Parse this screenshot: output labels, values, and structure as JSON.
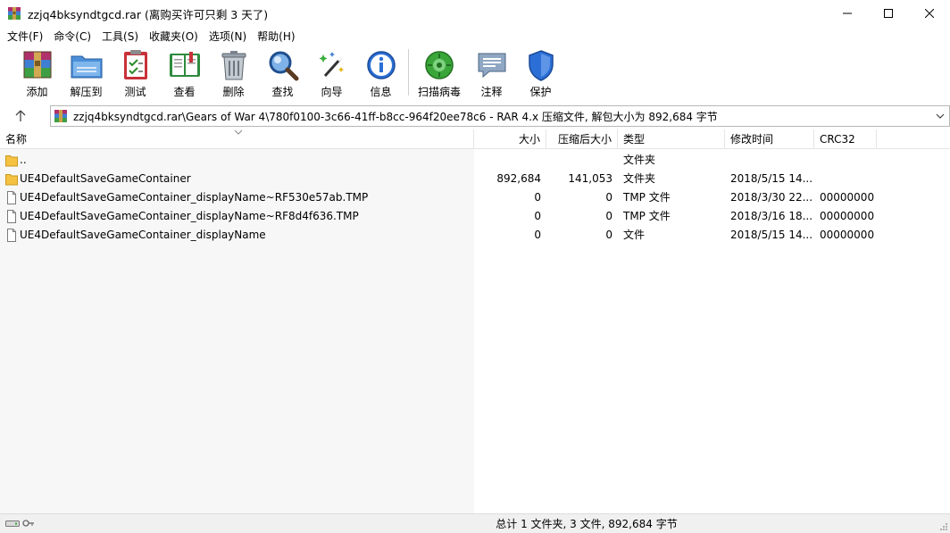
{
  "window": {
    "title": "zzjq4bksyndtgcd.rar (离购买许可只剩 3 天了)",
    "minimize_icon": "minimize-icon",
    "maximize_icon": "maximize-icon",
    "close_icon": "close-icon"
  },
  "menu": [
    {
      "label": "文件(F)"
    },
    {
      "label": "命令(C)"
    },
    {
      "label": "工具(S)"
    },
    {
      "label": "收藏夹(O)"
    },
    {
      "label": "选项(N)"
    },
    {
      "label": "帮助(H)"
    }
  ],
  "toolbar": [
    {
      "label": "添加",
      "icon": "add-archive-icon"
    },
    {
      "label": "解压到",
      "icon": "extract-folder-icon"
    },
    {
      "label": "测试",
      "icon": "test-clipboard-icon"
    },
    {
      "label": "查看",
      "icon": "view-book-icon"
    },
    {
      "label": "删除",
      "icon": "trash-icon"
    },
    {
      "label": "查找",
      "icon": "magnifier-icon"
    },
    {
      "label": "向导",
      "icon": "wizard-wand-icon"
    },
    {
      "label": "信息",
      "icon": "info-icon"
    },
    {
      "label": "扫描病毒",
      "icon": "virus-scan-icon"
    },
    {
      "label": "注释",
      "icon": "comment-icon"
    },
    {
      "label": "保护",
      "icon": "shield-icon"
    }
  ],
  "address": {
    "path": "zzjq4bksyndtgcd.rar\\Gears of War 4\\780f0100-3c66-41ff-b8cc-964f20ee78c6 - RAR 4.x 压缩文件, 解包大小为 892,684 字节"
  },
  "columns": {
    "name": "名称",
    "size": "大小",
    "packed": "压缩后大小",
    "type": "类型",
    "modified": "修改时间",
    "crc": "CRC32"
  },
  "rows": [
    {
      "name": "..",
      "size": "",
      "packed": "",
      "type": "文件夹",
      "modified": "",
      "crc": "",
      "kind": "folder"
    },
    {
      "name": "UE4DefaultSaveGameContainer",
      "size": "892,684",
      "packed": "141,053",
      "type": "文件夹",
      "modified": "2018/5/15 14...",
      "crc": "",
      "kind": "folder"
    },
    {
      "name": "UE4DefaultSaveGameContainer_displayName~RF530e57ab.TMP",
      "size": "0",
      "packed": "0",
      "type": "TMP 文件",
      "modified": "2018/3/30 22...",
      "crc": "00000000",
      "kind": "file"
    },
    {
      "name": "UE4DefaultSaveGameContainer_displayName~RF8d4f636.TMP",
      "size": "0",
      "packed": "0",
      "type": "TMP 文件",
      "modified": "2018/3/16 18...",
      "crc": "00000000",
      "kind": "file"
    },
    {
      "name": "UE4DefaultSaveGameContainer_displayName",
      "size": "0",
      "packed": "0",
      "type": "文件",
      "modified": "2018/5/15 14...",
      "crc": "00000000",
      "kind": "file"
    }
  ],
  "status": {
    "text": "总计 1 文件夹, 3 文件, 892,684 字节"
  },
  "colors": {
    "folder": "#f5c242",
    "accent_blue": "#2b6fd6",
    "header_divider": "#e5e5e5"
  }
}
